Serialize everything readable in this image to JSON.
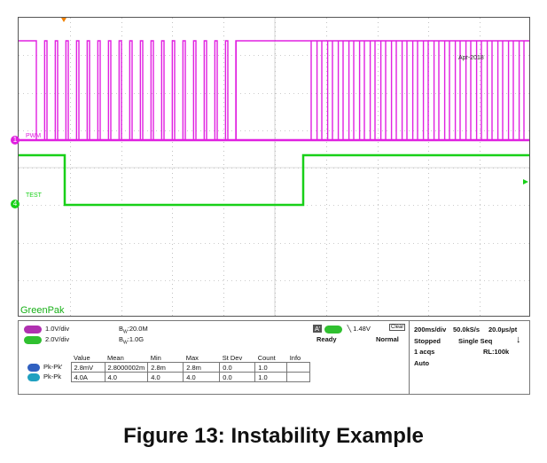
{
  "scope": {
    "brand": "GreenPak",
    "date": "Apr-2018",
    "ch1_label": "PWM",
    "ch4_label": "TEST",
    "ch1_marker": "1",
    "ch4_marker": "4",
    "colors": {
      "ch1": "#e020e0",
      "ch4": "#18d018",
      "grid": "#9a9a9a"
    }
  },
  "info": {
    "ch1": {
      "badge": "C1",
      "scale": "1.0V/div",
      "bw": "20.0M"
    },
    "ch4": {
      "badge": "C4",
      "scale": "2.0V/div",
      "bw": "1.0G"
    },
    "bw_prefix1": "B",
    "bw_prefix2": "B",
    "trigger": {
      "a": "A'",
      "ch": "C4",
      "level": "1.48V",
      "state": "Ready",
      "mode": "Normal",
      "icon_label": "Clear"
    },
    "timebase": {
      "scale": "200ms/div",
      "rate": "50.0kS/s",
      "resolution": "20.0µs/pt",
      "status": "Stopped",
      "seq": "Single Seq",
      "acqs": "1 acqs",
      "rl": "RL:100k",
      "auto": "Auto"
    },
    "measurements": {
      "headers": [
        "Value",
        "Mean",
        "Min",
        "Max",
        "St Dev",
        "Count",
        "Info"
      ],
      "rows": [
        {
          "badge": "C1",
          "name": "Pk-Pk'",
          "cells": [
            "2.8mV",
            "2.8000002m",
            "2.8m",
            "2.8m",
            "0.0",
            "1.0",
            ""
          ]
        },
        {
          "badge": "C4",
          "name": "Pk-Pk",
          "cells": [
            "4.0A",
            "4.0",
            "4.0",
            "4.0",
            "0.0",
            "1.0",
            ""
          ]
        }
      ]
    }
  },
  "caption": "Figure 13: Instability Example"
}
